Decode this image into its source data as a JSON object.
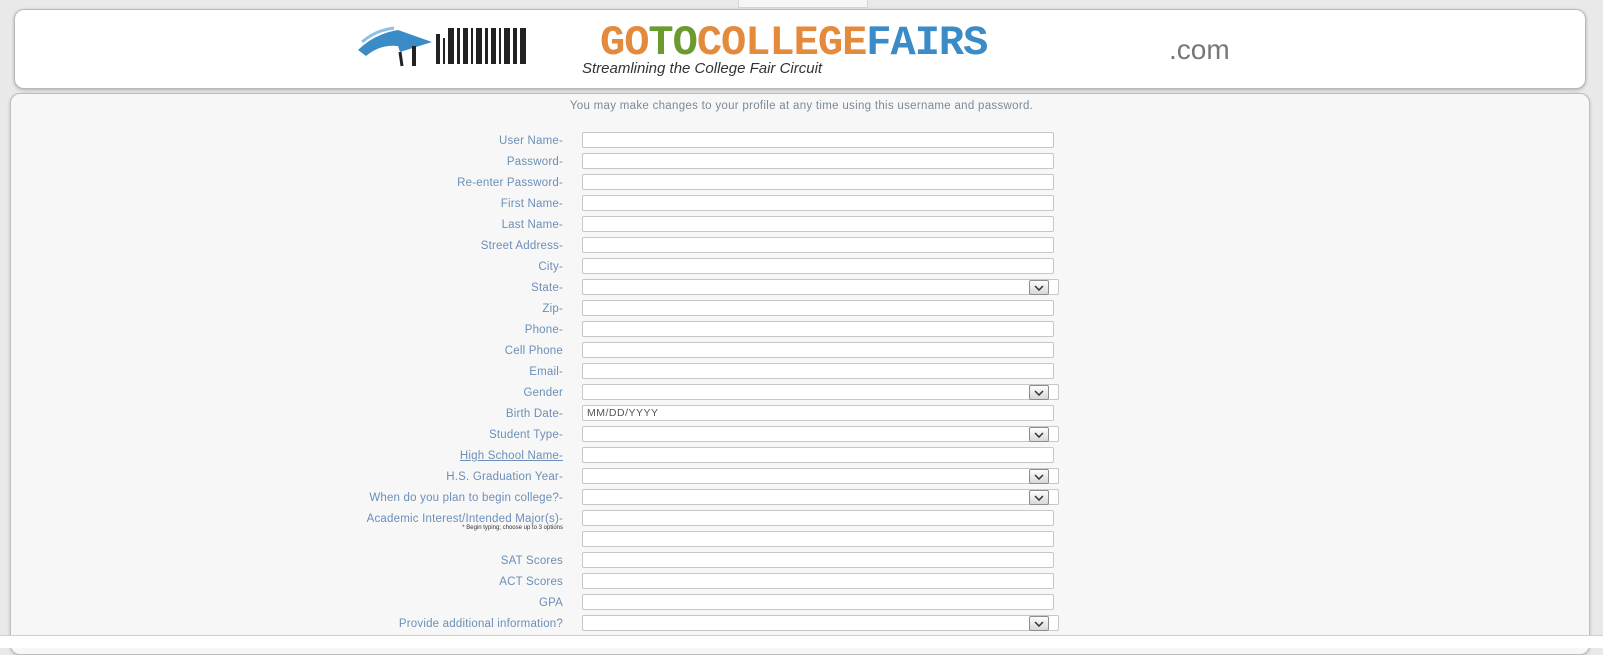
{
  "brand": {
    "word_go": "GO",
    "word_to": "TO",
    "word_college": "COLLEGE",
    "word_fairs": "FAIRS",
    "suffix": ".com",
    "tagline": "Streamlining the College Fair Circuit",
    "colors": {
      "orange": "#e48a3c",
      "green": "#6b9a2e",
      "blue": "#3b8bc6",
      "gray": "#777777"
    }
  },
  "intro": "You may make changes to your profile at any time using this username and password.",
  "form": {
    "fields": [
      {
        "label": "User Name-",
        "type": "text"
      },
      {
        "label": "Password-",
        "type": "password"
      },
      {
        "label": "Re-enter Password-",
        "type": "password"
      },
      {
        "label": "First Name-",
        "type": "text"
      },
      {
        "label": "Last Name-",
        "type": "text"
      },
      {
        "label": "Street Address-",
        "type": "text"
      },
      {
        "label": "City-",
        "type": "text"
      },
      {
        "label": "State-",
        "type": "select"
      },
      {
        "label": "Zip-",
        "type": "text"
      },
      {
        "label": "Phone-",
        "type": "text"
      },
      {
        "label": "Cell Phone",
        "type": "text"
      },
      {
        "label": "Email-",
        "type": "text"
      },
      {
        "label": "Gender",
        "type": "select"
      },
      {
        "label": "Birth Date-",
        "type": "text",
        "value": "MM/DD/YYYY"
      },
      {
        "label": "Student Type-",
        "type": "select"
      },
      {
        "label": "High School Name-",
        "type": "text",
        "link": true
      },
      {
        "label": "H.S. Graduation Year-",
        "type": "select"
      },
      {
        "label": "When do you plan to begin college?-",
        "type": "select"
      },
      {
        "label": "Academic Interest/Intended Major(s)-",
        "sublabel": "* Begin typing; choose up to 3 options",
        "type": "text"
      },
      {
        "label": "",
        "type": "text"
      },
      {
        "label": "SAT Scores",
        "type": "text"
      },
      {
        "label": "ACT Scores",
        "type": "text"
      },
      {
        "label": "GPA",
        "type": "text"
      },
      {
        "label": "Provide additional information?",
        "type": "select"
      }
    ]
  }
}
